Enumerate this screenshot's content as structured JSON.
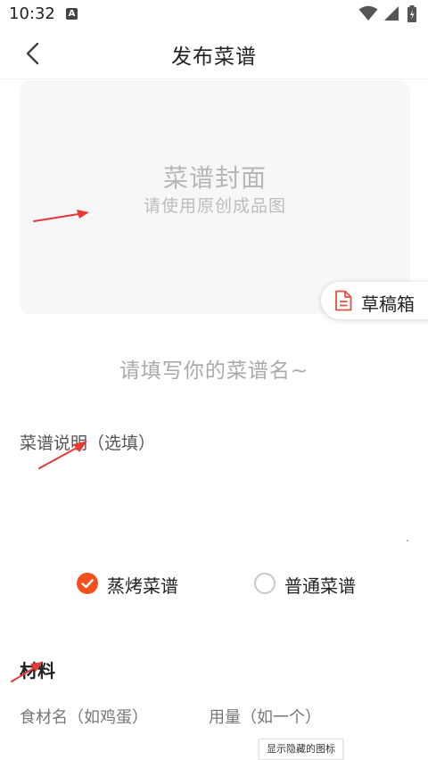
{
  "status_bar": {
    "time": "10:32",
    "notification_icon": "A"
  },
  "header": {
    "back_icon": "chevron-left-icon",
    "title": "发布菜谱"
  },
  "cover": {
    "title": "菜谱封面",
    "hint": "请使用原创成品图"
  },
  "draft_box": {
    "label": "草稿箱",
    "icon": "document-icon"
  },
  "form": {
    "recipe_name_placeholder": "请填写你的菜谱名~",
    "description_placeholder": "菜谱说明（选填）"
  },
  "recipe_type": {
    "options": [
      {
        "label": "蒸烤菜谱",
        "selected": true
      },
      {
        "label": "普通菜谱",
        "selected": false
      }
    ]
  },
  "ingredients": {
    "title": "材料",
    "name_placeholder": "食材名（如鸡蛋）",
    "quantity_placeholder": "用量（如一个）"
  },
  "tooltip": "显示隐藏的图标",
  "colors": {
    "accent": "#f4511e",
    "arrow": "#e53935",
    "placeholder": "#b7b7b7"
  }
}
